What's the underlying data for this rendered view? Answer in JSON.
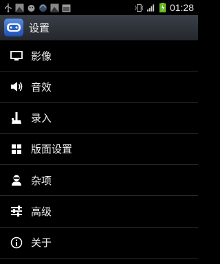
{
  "status_bar": {
    "time": "01:28",
    "left_icons": [
      "usb-icon",
      "image-notify-icon",
      "android-notify-icon",
      "sync-notify-icon",
      "image-notify-icon",
      "calendar-notify-icon"
    ],
    "right_icons": [
      "vibrate-icon",
      "signal-icon",
      "battery-icon"
    ]
  },
  "title_bar": {
    "title": "设置",
    "app_icon": "gamepad-app-icon"
  },
  "menu": {
    "items": [
      {
        "label": "影像",
        "icon": "monitor-icon"
      },
      {
        "label": "音效",
        "icon": "speaker-icon"
      },
      {
        "label": "录入",
        "icon": "joystick-icon"
      },
      {
        "label": "版面设置",
        "icon": "grid-icon"
      },
      {
        "label": "杂项",
        "icon": "person-icon"
      },
      {
        "label": "高级",
        "icon": "sliders-icon"
      },
      {
        "label": "关于",
        "icon": "info-icon"
      }
    ]
  },
  "colors": {
    "background": "#000000",
    "title_bar": "#2e3238",
    "divider": "#2a2a2a",
    "text": "#f2f2f2"
  }
}
